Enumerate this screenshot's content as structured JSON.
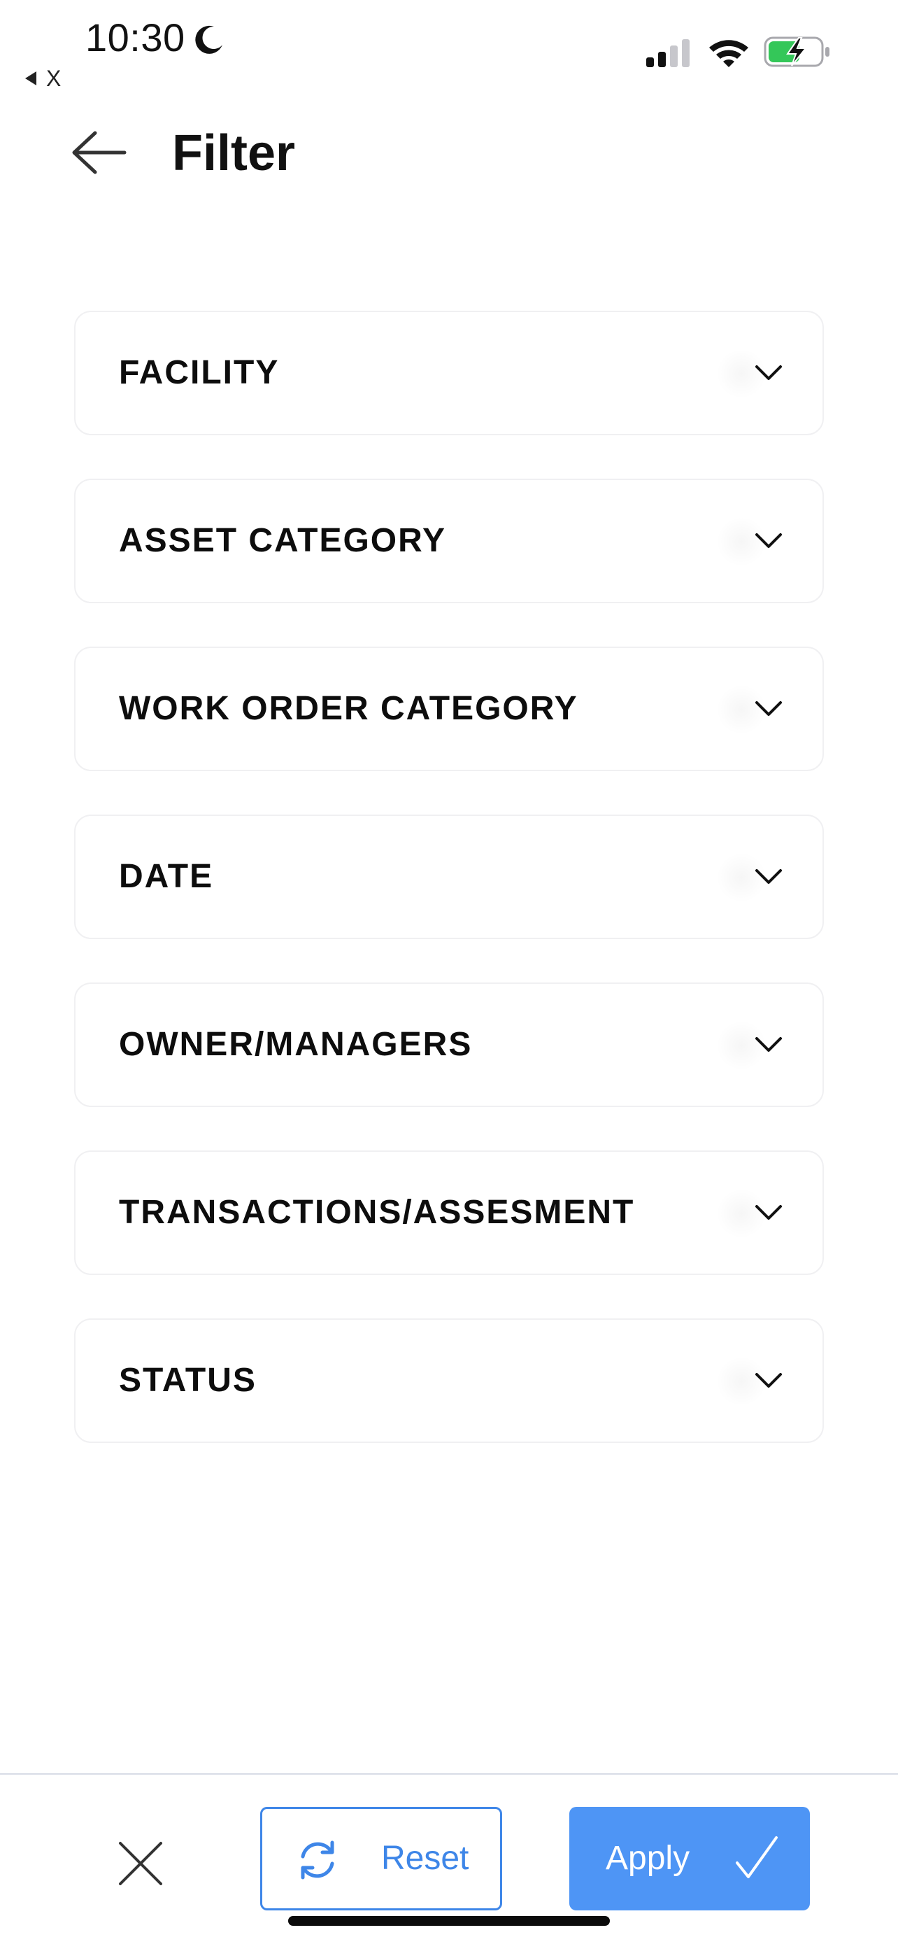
{
  "status_bar": {
    "time": "10:30",
    "back_app_label": "X",
    "icons": [
      "moon-icon",
      "signal-icon",
      "wifi-icon",
      "battery-charging-icon"
    ],
    "battery_color": "#34c759"
  },
  "header": {
    "back_icon": "arrow-left-icon",
    "title": "Filter"
  },
  "filters": [
    {
      "label": "FACILITY",
      "icon": "chevron-down-icon"
    },
    {
      "label": "ASSET CATEGORY",
      "icon": "chevron-down-icon"
    },
    {
      "label": "WORK ORDER CATEGORY",
      "icon": "chevron-down-icon"
    },
    {
      "label": "DATE",
      "icon": "chevron-down-icon"
    },
    {
      "label": "OWNER/MANAGERS",
      "icon": "chevron-down-icon"
    },
    {
      "label": "TRANSACTIONS/ASSESMENT",
      "icon": "chevron-down-icon"
    },
    {
      "label": "STATUS",
      "icon": "chevron-down-icon"
    }
  ],
  "footer": {
    "close_icon": "close-icon",
    "reset_label": "Reset",
    "reset_icon": "refresh-icon",
    "apply_label": "Apply",
    "apply_icon": "checkmark-icon",
    "accent_color": "#3e86e8",
    "apply_bg_color": "#4e95f5"
  }
}
